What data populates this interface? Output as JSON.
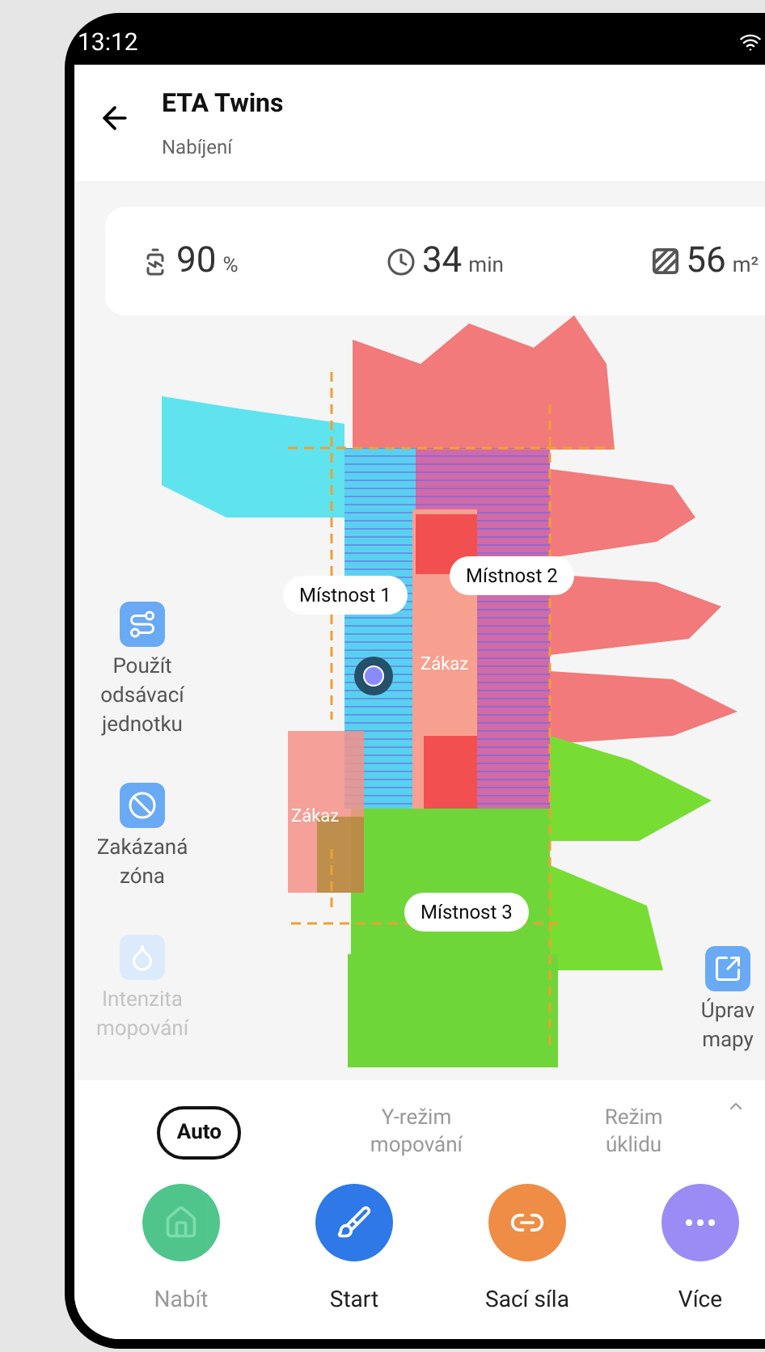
{
  "status_bar": {
    "time": "13:12"
  },
  "header": {
    "title": "ETA Twins",
    "subtitle": "Nabíjení"
  },
  "stats": [
    {
      "kind": "battery",
      "value": "90",
      "unit": "%"
    },
    {
      "kind": "time",
      "value": "34",
      "unit": "min"
    },
    {
      "kind": "area",
      "value": "56",
      "unit": "m²"
    }
  ],
  "map": {
    "rooms": [
      {
        "label": "Místnost 1"
      },
      {
        "label": "Místnost 2"
      },
      {
        "label": "Místnost 3"
      }
    ],
    "zones": [
      {
        "label": "Zákaz"
      },
      {
        "label": "Zákaz"
      }
    ]
  },
  "left_tools": [
    {
      "kind": "vacuum",
      "label": "Použít odsávací jednotku",
      "disabled": false
    },
    {
      "kind": "no_go",
      "label": "Zakázaná zóna",
      "disabled": false
    },
    {
      "kind": "mop",
      "label": "Intenzita mopování",
      "disabled": true
    }
  ],
  "right_tool": {
    "label": "Úprav mapy"
  },
  "modes": [
    {
      "label": "Auto",
      "selected": true
    },
    {
      "label": "Y-režim mopování",
      "selected": false
    },
    {
      "label": "Režim úklidu",
      "selected": false
    }
  ],
  "actions": [
    {
      "kind": "charge",
      "label": "Nabít",
      "disabled": true
    },
    {
      "kind": "start",
      "label": "Start",
      "disabled": false
    },
    {
      "kind": "suction",
      "label": "Sací síla",
      "disabled": false
    },
    {
      "kind": "more",
      "label": "Více",
      "disabled": false
    }
  ]
}
